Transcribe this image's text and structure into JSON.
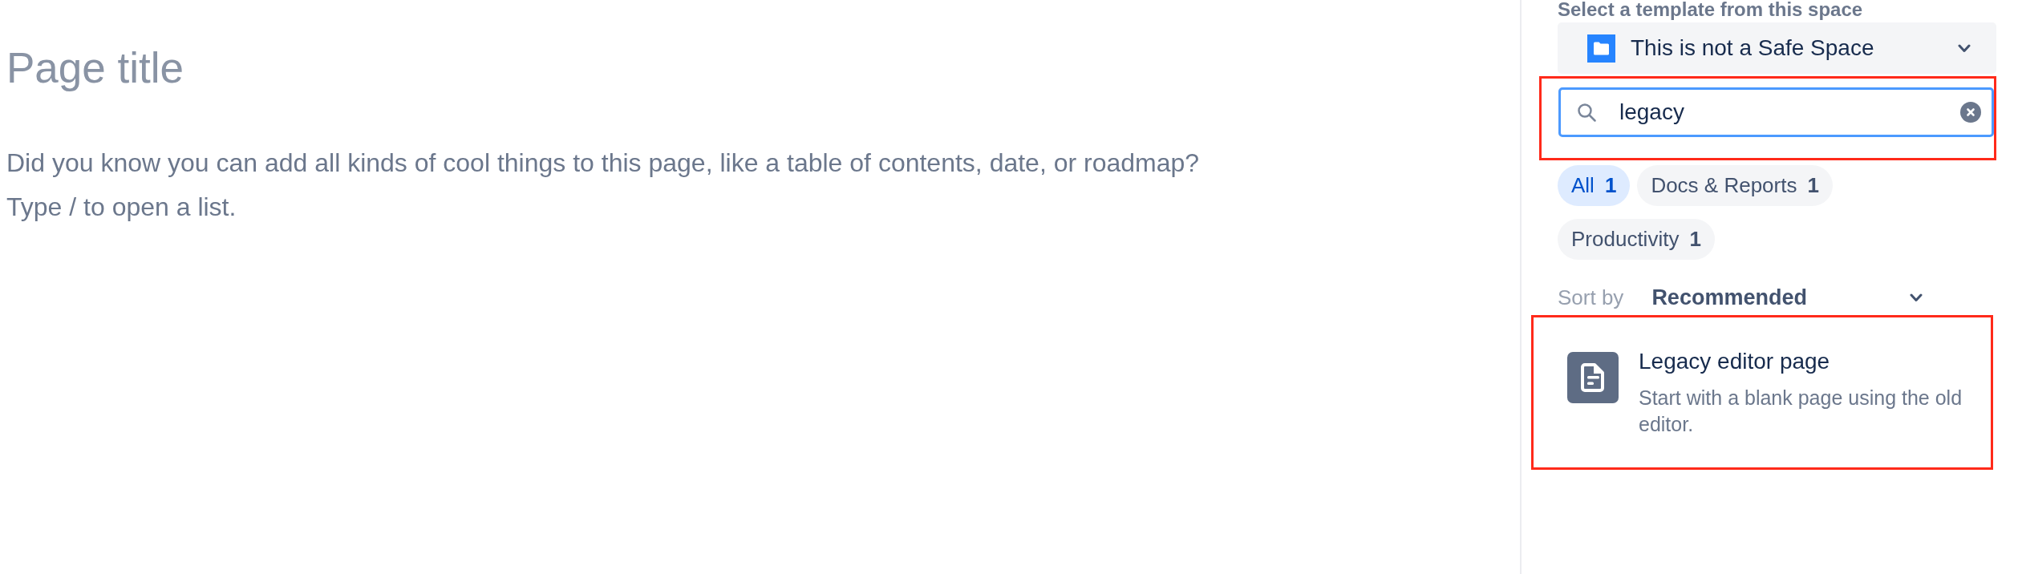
{
  "editor": {
    "title_placeholder": "Page title",
    "body_placeholder": [
      "Did you know you can add all kinds of cool things to this page, like a table of contents, date, or roadmap?",
      "Type / to open a list."
    ]
  },
  "template_panel": {
    "section_label": "Select a template from this space",
    "space_select": {
      "value": "This is not a Safe Space"
    },
    "search": {
      "value": "legacy",
      "highlighted": true
    },
    "filters": [
      {
        "label": "All",
        "count": "1",
        "selected": true
      },
      {
        "label": "Docs & Reports",
        "count": "1",
        "selected": false
      },
      {
        "label": "Productivity",
        "count": "1",
        "selected": false
      }
    ],
    "sort": {
      "label": "Sort by",
      "value": "Recommended"
    },
    "results": [
      {
        "title": "Legacy editor page",
        "description": "Start with a blank page using the old editor.",
        "highlighted": true
      }
    ]
  }
}
